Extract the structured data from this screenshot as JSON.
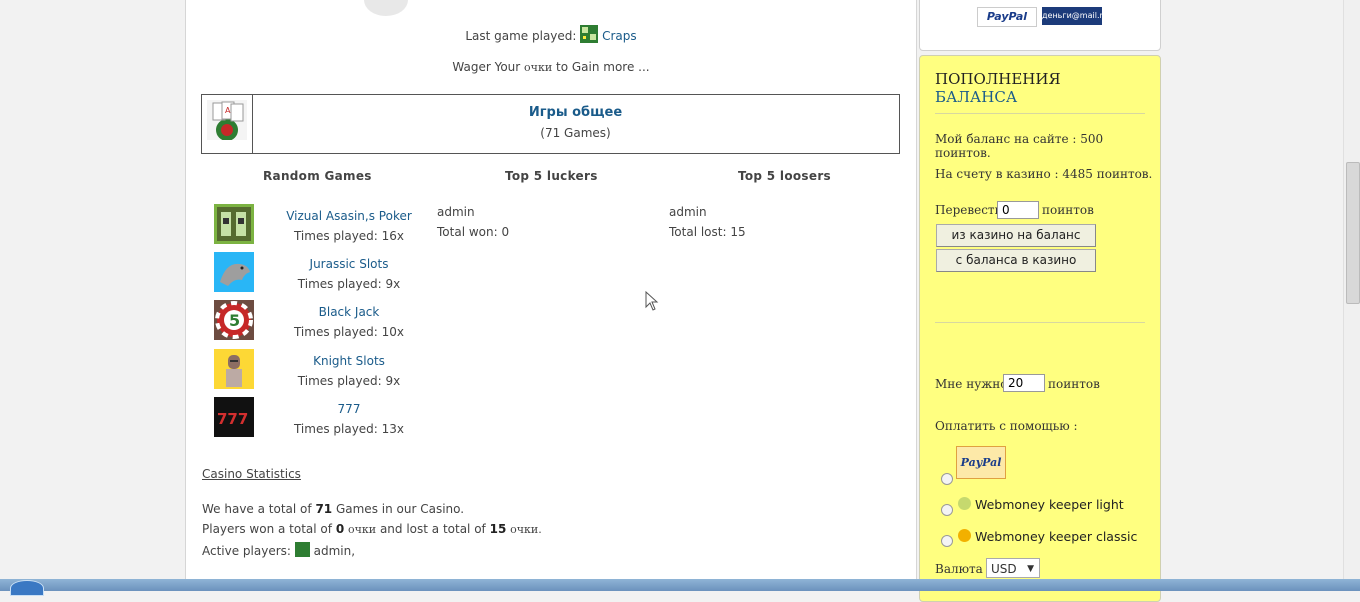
{
  "last_game": {
    "label": "Last game played:",
    "game": "Craps"
  },
  "wager": {
    "prefix": "Wager Your",
    "unit": "очки",
    "suffix": "to Gain more ..."
  },
  "category": {
    "title": "Игры общее",
    "count": "(71 Games)"
  },
  "columns": {
    "random": "Random Games",
    "luckers": "Top 5 luckers",
    "loosers": "Top 5 loosers"
  },
  "games": [
    {
      "name": "Vizual Asasin,s Poker",
      "played": "Times played: 16x",
      "icon": "poker-icon"
    },
    {
      "name": "Jurassic Slots",
      "played": "Times played: 9x",
      "icon": "dinosaur-icon"
    },
    {
      "name": "Black Jack",
      "played": "Times played: 10x",
      "icon": "chip-icon"
    },
    {
      "name": "Knight Slots",
      "played": "Times played: 9x",
      "icon": "knight-icon"
    },
    {
      "name": "777",
      "played": "Times played: 13x",
      "icon": "sevens-icon"
    }
  ],
  "luckers": {
    "user": "admin",
    "total": "Total won: 0"
  },
  "loosers": {
    "user": "admin",
    "total": "Total lost: 15"
  },
  "stats": {
    "title": "Casino Statistics",
    "total_prefix": "We have a total of",
    "total_games": "71",
    "total_suffix": "Games in our Casino.",
    "won_prefix": "Players won a total of",
    "won": "0",
    "unit": "очки",
    "lost_mid": "and lost a total of",
    "lost": "15",
    "unit2": "очки.",
    "active_label": "Active players:",
    "active_user": "admin,"
  },
  "top_payments": {
    "paypal": "PayPal",
    "money_mail": "деньги@mail.ru"
  },
  "sidebar": {
    "heading_1": "ПОПОЛНЕНИЯ",
    "heading_2": "БАЛАНСА",
    "balance_site": "Мой баланс на сайте : 500 поинтов.",
    "balance_casino": "На счету в казино : 4485 поинтов.",
    "transfer_label": "Перевести",
    "transfer_value": "0",
    "transfer_unit": "поинтов",
    "btn_to_balance": "из казино на баланс",
    "btn_to_casino": "с баланса в казино",
    "need_label": "Мне нужно",
    "need_value": "20",
    "need_unit": "поинтов",
    "pay_with": "Оплатить с помощью :",
    "paypal": "PayPal",
    "wm_light": "Webmoney keeper light",
    "wm_classic": "Webmoney keeper classic",
    "currency_label": "Валюта :",
    "currency_value": "USD"
  }
}
